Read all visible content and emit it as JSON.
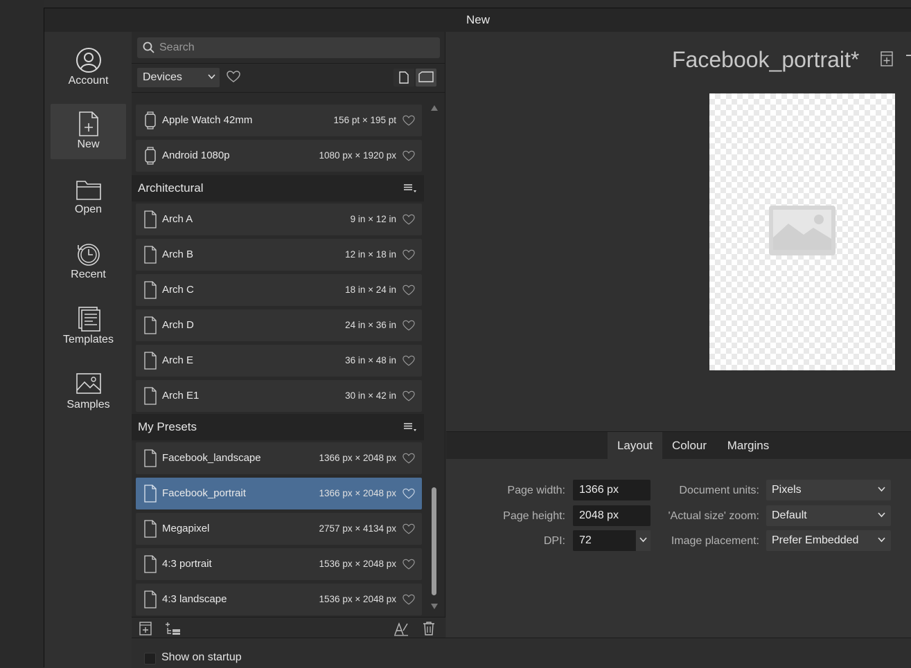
{
  "window": {
    "title": "New"
  },
  "nav": {
    "account": "Account",
    "new": "New",
    "open": "Open",
    "recent": "Recent",
    "templates": "Templates",
    "samples": "Samples"
  },
  "search": {
    "placeholder": "Search"
  },
  "filter": {
    "category": "Devices"
  },
  "presets": {
    "devices": [
      {
        "name": "Apple Watch 42mm",
        "size": "156 pt × 195 pt"
      },
      {
        "name": "Android 1080p",
        "size": "1080 px × 1920 px"
      }
    ],
    "architectural": {
      "title": "Architectural",
      "items": [
        {
          "name": "Arch A",
          "size": "9 in × 12 in"
        },
        {
          "name": "Arch B",
          "size": "12 in × 18 in"
        },
        {
          "name": "Arch C",
          "size": "18 in × 24 in"
        },
        {
          "name": "Arch D",
          "size": "24 in × 36 in"
        },
        {
          "name": "Arch E",
          "size": "36 in × 48 in"
        },
        {
          "name": "Arch E1",
          "size": "30 in × 42 in"
        }
      ]
    },
    "my_presets": {
      "title": "My Presets",
      "items": [
        {
          "name": "Facebook_landscape",
          "size": "1366 px × 2048 px"
        },
        {
          "name": "Facebook_portrait",
          "size": "1366 px × 2048 px",
          "selected": true
        },
        {
          "name": "Megapixel",
          "size": "2757 px × 4134 px"
        },
        {
          "name": "4:3 portrait",
          "size": "1536 px × 2048 px"
        },
        {
          "name": "4:3 landscape",
          "size": "1536 px × 2048 px"
        }
      ]
    }
  },
  "document": {
    "title": "Facebook_portrait*"
  },
  "tabs": {
    "layout": "Layout",
    "colour": "Colour",
    "margins": "Margins"
  },
  "layout": {
    "page_width_label": "Page width:",
    "page_width": "1366 px",
    "page_height_label": "Page height:",
    "page_height": "2048 px",
    "dpi_label": "DPI:",
    "dpi": "72",
    "units_label": "Document units:",
    "units": "Pixels",
    "zoom_label": "'Actual size' zoom:",
    "zoom": "Default",
    "placement_label": "Image placement:",
    "placement": "Prefer Embedded"
  },
  "footer": {
    "show_on_startup": "Show on startup"
  },
  "colors": {
    "selected_row": "#4a6d95",
    "background": "#303030"
  }
}
